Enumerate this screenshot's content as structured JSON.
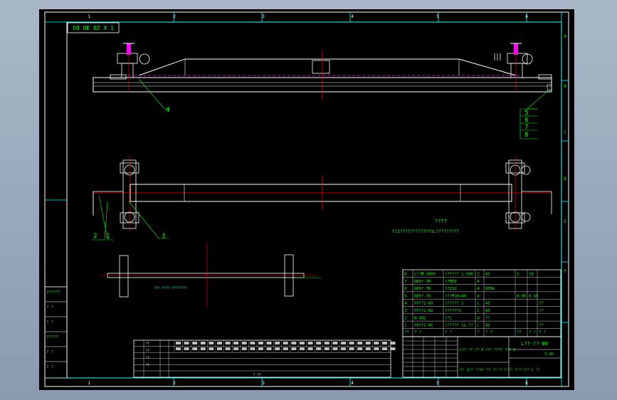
{
  "drawing": {
    "stamp": "00 0E 0Z X 1",
    "zones_top": [
      "1",
      "2",
      "3",
      "4",
      "5",
      "6"
    ],
    "zones_bottom": [
      "1",
      "2",
      "3",
      "4",
      "5",
      "6"
    ],
    "zones_side": [
      "A",
      "B",
      "C",
      "D",
      "E",
      "F"
    ],
    "balloons": [
      "1",
      "2",
      "3",
      "4",
      "5",
      "6",
      "7",
      "8"
    ],
    "note_code": "????",
    "note_text": "YJ1????????????1L?????????",
    "shaft_note": "??? ????? ?????????",
    "bom_rows": [
      {
        "no": "8",
        "code": "L??M 1000",
        "name": "??Y??? 1:500",
        "qty": "2",
        "mat": "A3",
        "w1": "5",
        "w2": "10",
        "note": ""
      },
      {
        "no": "7",
        "code": "GB9?-76",
        "name": "??M10",
        "qty": "4",
        "mat": "",
        "w1": "",
        "w2": "",
        "note": ""
      },
      {
        "no": "6",
        "code": "GB9?-76",
        "name": "??Z12",
        "qty": "4",
        "mat": "65Mn",
        "w1": "",
        "w2": "",
        "note": ""
      },
      {
        "no": "5",
        "code": "GB9?-76",
        "name": "???M10×40",
        "qty": "4",
        "mat": "",
        "w1": "0.06",
        "w2": "0.46",
        "note": ""
      },
      {
        "no": "4",
        "code": "Y0??2-03",
        "name": "?????? 1",
        "qty": "1",
        "mat": "A3",
        "w1": "",
        "w2": "",
        "note": "??"
      },
      {
        "no": "3",
        "code": "Y0??2-02",
        "name": "??????2",
        "qty": "1",
        "mat": "A3",
        "w1": "",
        "w2": "",
        "note": "??"
      },
      {
        "no": "2",
        "code": "D-102",
        "name": "??1",
        "qty": "4",
        "mat": "??",
        "w1": "",
        "w2": "",
        "note": ""
      },
      {
        "no": "1",
        "code": "Y0??2-01",
        "name": "?????? 1L-??",
        "qty": "1",
        "mat": "A3",
        "w1": "",
        "w2": "",
        "note": "??"
      }
    ],
    "bom_header": [
      "??",
      "?  ?",
      "?  ?",
      "?",
      "?  ?",
      "??",
      "?  ?",
      "?  ?"
    ],
    "title_main": "L?? ?? ?? 0 ??? ???? ??? 1",
    "title_sub": "??? 1L?? ???0? ??? ?? ?? 1???? ???? 1?? 3- ??",
    "drawing_no": "L??-??-00",
    "scale": "1:20",
    "left_labels": [
      "??????",
      "?  ?",
      "?  ?",
      "?????",
      "?  ?",
      "?  ?"
    ],
    "rev_labels": [
      "??",
      "??",
      "??",
      "??"
    ],
    "rev_bottom": "? ??"
  }
}
